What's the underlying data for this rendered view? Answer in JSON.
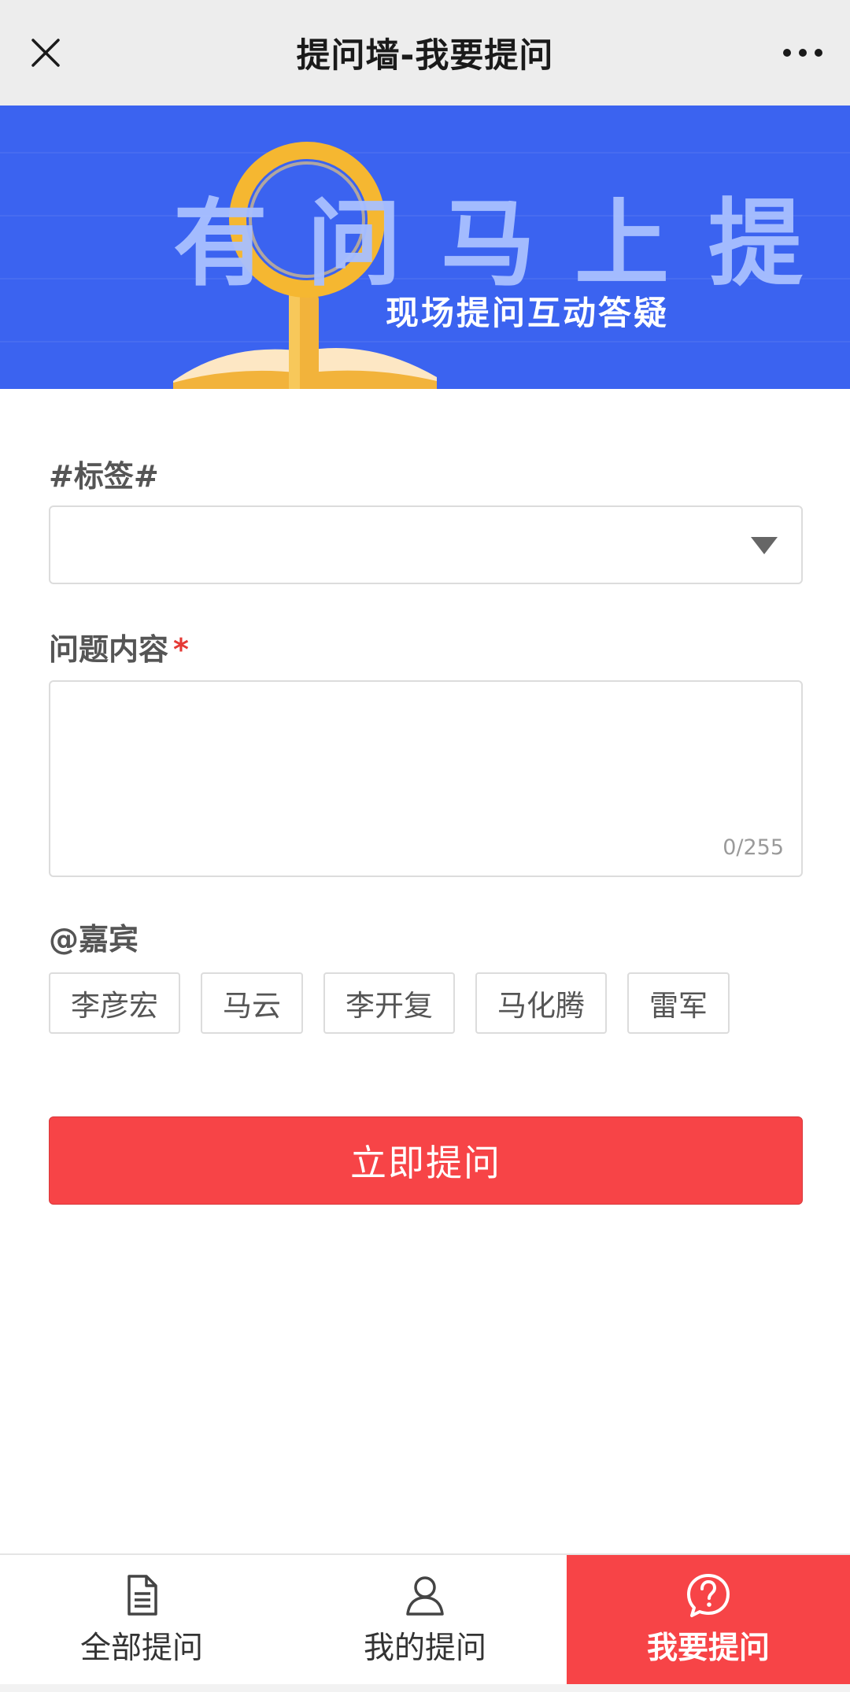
{
  "navbar": {
    "title": "提问墙-我要提问",
    "close_icon": "close-icon",
    "more_icon": "more-dots-icon"
  },
  "banner": {
    "headline": "有问马上提",
    "subtitle": "现场提问互动答疑",
    "background_color": "#3b63f0",
    "magnifier_color": "#f5b731"
  },
  "form": {
    "tag_label": "#标签#",
    "tag_select_value": "",
    "question_label": "问题内容",
    "required_mark": "*",
    "question_value": "",
    "char_count": "0/255",
    "guests_label": "@嘉宾",
    "guests": [
      "李彦宏",
      "马云",
      "李开复",
      "马化腾",
      "雷军"
    ],
    "submit_label": "立即提问",
    "submit_color": "#f74447"
  },
  "tabbar": {
    "tabs": [
      {
        "label": "全部提问",
        "icon": "document-icon",
        "active": false
      },
      {
        "label": "我的提问",
        "icon": "user-icon",
        "active": false
      },
      {
        "label": "我要提问",
        "icon": "question-circle-icon",
        "active": true
      }
    ],
    "active_color": "#f74447"
  }
}
